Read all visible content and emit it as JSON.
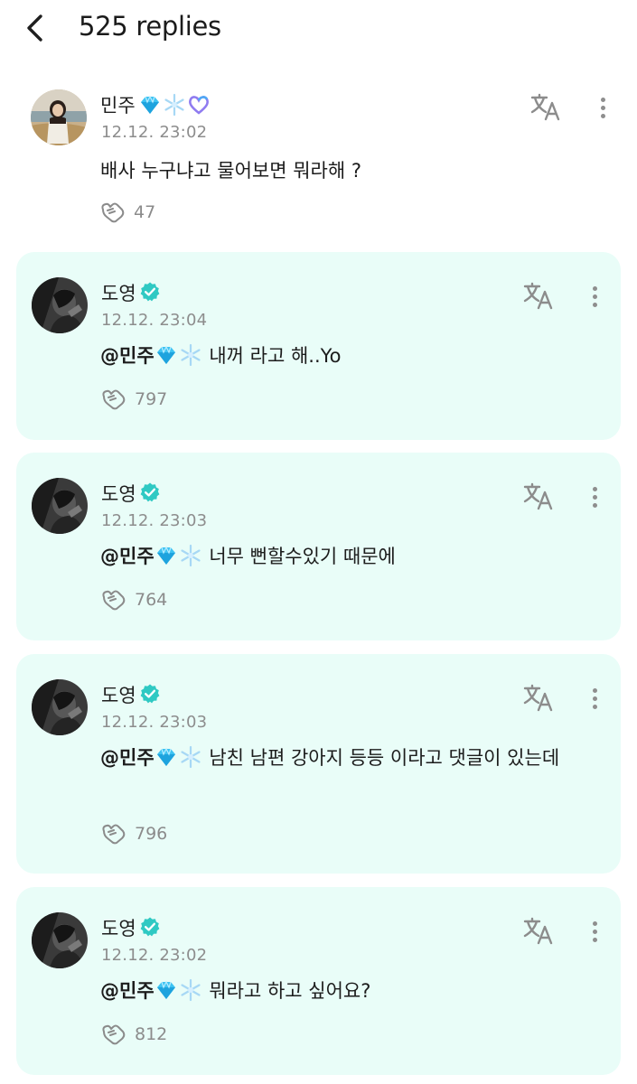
{
  "header": {
    "title": "525 replies"
  },
  "root_comment": {
    "author": "민주",
    "date": "12.12. 23:02",
    "text": "배사 누구냐고 물어보면 뭐라해 ?",
    "likes": "47"
  },
  "replies": [
    {
      "author": "도영",
      "date": "12.12. 23:04",
      "mention": "@민주",
      "text": "내꺼 라고 해..Yo",
      "likes": "797"
    },
    {
      "author": "도영",
      "date": "12.12. 23:03",
      "mention": "@민주",
      "text": "너무 뻔할수있기 때문에",
      "likes": "764"
    },
    {
      "author": "도영",
      "date": "12.12. 23:03",
      "mention": "@민주",
      "text": "남친 남편 강아지 등등 이라고 댓글이 있는데",
      "likes": "796"
    },
    {
      "author": "도영",
      "date": "12.12. 23:02",
      "mention": "@민주",
      "text": "뭐라고 하고 싶어요?",
      "likes": "812"
    }
  ],
  "icons": {
    "back": "chevron-left-icon",
    "translate": "translate-icon",
    "more": "more-vertical-icon",
    "like": "heart-hands-icon",
    "verified": "verified-badge-icon"
  },
  "colors": {
    "reply_background": "#e9fdf8",
    "verified": "#2fc9c3",
    "diamond": "#3ec3f2",
    "snowflake": "#a7d8f5",
    "heart_outline": "#8f7bf0"
  }
}
